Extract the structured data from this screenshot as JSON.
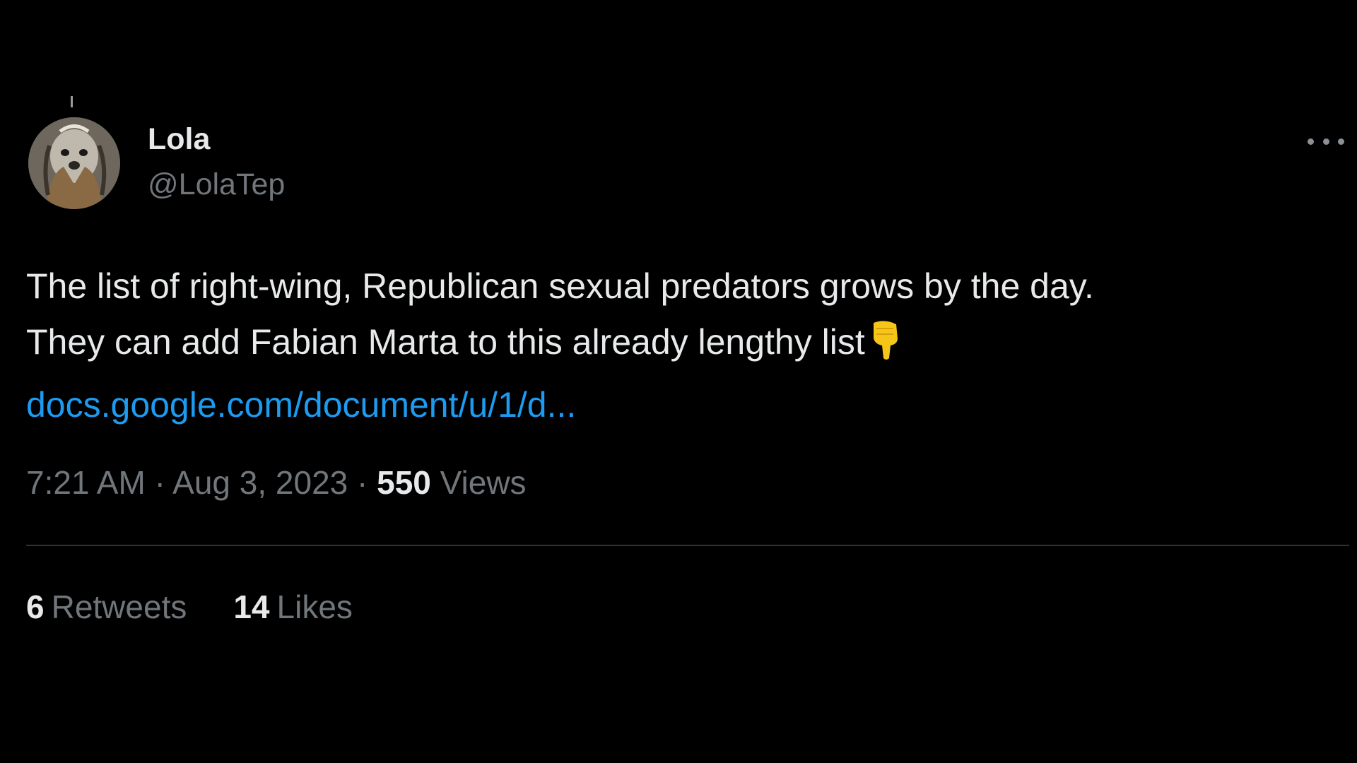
{
  "tweet": {
    "author": {
      "display_name": "Lola",
      "handle": "@LolaTep"
    },
    "text_line_1": "The list of right-wing, Republican s⁠exual predators grows by the day.",
    "text_line_2": "They can add Fabian Marta to this already lengthy list",
    "emoji_icon": "backhand-index-pointing-down-icon",
    "link_text": "docs.google.com/document/u/1/d...",
    "time": "7:21 AM",
    "separator": "·",
    "date": "Aug 3, 2023",
    "views_count": "550",
    "views_label": "Views",
    "retweets_count": "6",
    "retweets_label": "Retweets",
    "likes_count": "14",
    "likes_label": "Likes"
  },
  "colors": {
    "background": "#000000",
    "primary_text": "#e7e9ea",
    "secondary_text": "#71767b",
    "link": "#1d9bf0",
    "divider": "#2f3336",
    "emoji": "#f5c518"
  }
}
